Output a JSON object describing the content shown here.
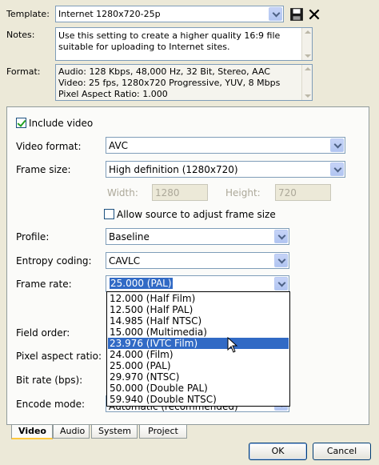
{
  "header": {
    "template_label": "Template:",
    "template_value": "Internet 1280x720-25p",
    "notes_label": "Notes:",
    "notes_text": "Use this setting to create a higher quality 16:9 file suitable for uploading to Internet sites.",
    "format_label": "Format:",
    "format_lines": [
      "Audio: 128 Kbps, 48,000 Hz, 32 Bit, Stereo, AAC",
      "Video: 25 fps, 1280x720 Progressive, YUV, 8 Mbps",
      "Pixel Aspect Ratio: 1.000"
    ]
  },
  "video": {
    "include_video_label": "Include video",
    "video_format_label": "Video format:",
    "video_format_value": "AVC",
    "frame_size_label": "Frame size:",
    "frame_size_value": "High definition (1280x720)",
    "width_label": "Width:",
    "width_value": "1280",
    "height_label": "Height:",
    "height_value": "720",
    "allow_source_label": "Allow source to adjust frame size",
    "profile_label": "Profile:",
    "profile_value": "Baseline",
    "entropy_label": "Entropy coding:",
    "entropy_value": "CAVLC",
    "frame_rate_label": "Frame rate:",
    "frame_rate_value": "25.000 (PAL)",
    "field_order_label": "Field order:",
    "pixel_aspect_label": "Pixel aspect ratio:",
    "bit_rate_label": "Bit rate (bps):",
    "encode_mode_label": "Encode mode:",
    "encode_mode_value": "Automatic (recommended)",
    "frame_rate_options": [
      "12.000 (Half Film)",
      "12.500 (Half PAL)",
      "14.985 (Half NTSC)",
      "15.000 (Multimedia)",
      "23.976 (IVTC Film)",
      "24.000 (Film)",
      "25.000 (PAL)",
      "29.970 (NTSC)",
      "50.000 (Double PAL)",
      "59.940 (Double NTSC)"
    ],
    "highlighted_option_index": 4
  },
  "tabs": [
    "Video",
    "Audio",
    "System",
    "Project"
  ],
  "buttons": {
    "ok": "OK",
    "cancel": "Cancel"
  },
  "colors": {
    "selection": "#316ac5",
    "dialog_bg": "#ece9d8",
    "field_border": "#7f9db9"
  }
}
